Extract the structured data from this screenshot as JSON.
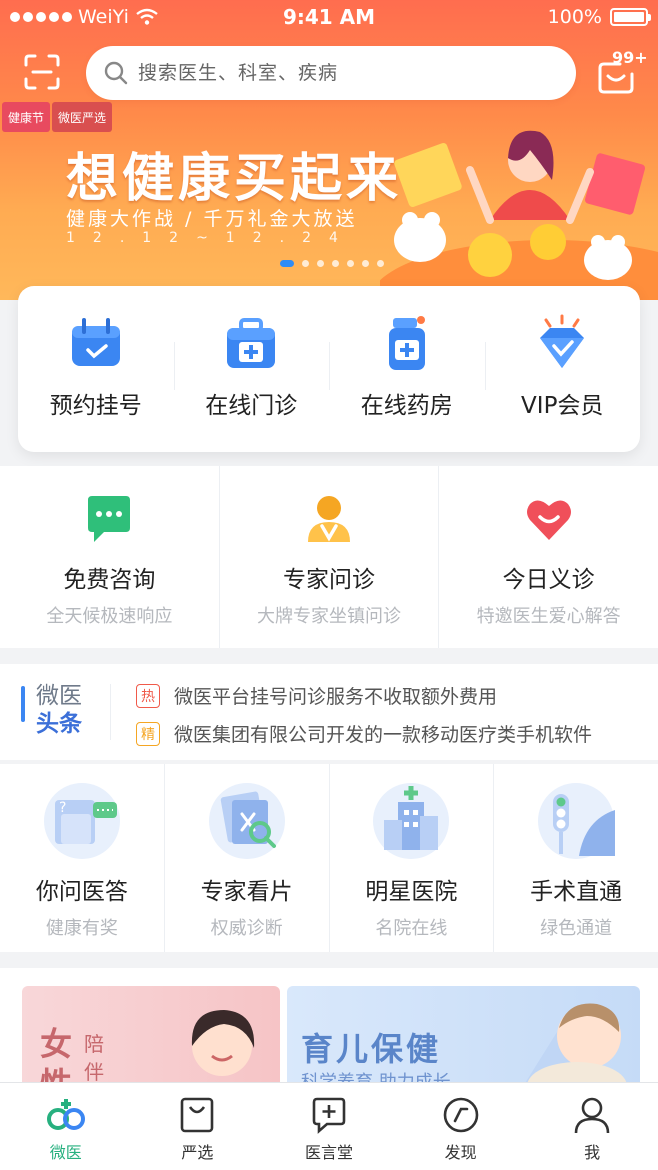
{
  "status_bar": {
    "signal_dots": 5,
    "carrier": "WeiYi",
    "time": "9:41 AM",
    "battery": "100%"
  },
  "header": {
    "search_placeholder": "搜索医生、科室、疾病",
    "message_badge": "99+"
  },
  "banner": {
    "badges": [
      "健康节",
      "微医严选"
    ],
    "title": "想健康买起来",
    "subtitle": "健康大作战 / 千万礼金大放送",
    "date": "12.12~12.24",
    "carousel_count": 7,
    "carousel_active": 0
  },
  "main_services": [
    {
      "label": "预约挂号",
      "icon": "calendar-icon"
    },
    {
      "label": "在线门诊",
      "icon": "medical-kit-icon"
    },
    {
      "label": "在线药房",
      "icon": "medicine-bottle-icon"
    },
    {
      "label": "VIP会员",
      "icon": "diamond-icon"
    }
  ],
  "consult": [
    {
      "title": "免费咨询",
      "subtitle": "全天候极速响应",
      "icon": "chat-bubble-icon"
    },
    {
      "title": "专家问诊",
      "subtitle": "大牌专家坐镇问诊",
      "icon": "doctor-icon"
    },
    {
      "title": "今日义诊",
      "subtitle": "特邀医生爱心解答",
      "icon": "heart-icon"
    }
  ],
  "news": {
    "brand_top": "微医",
    "brand_bottom": "头条",
    "items": [
      {
        "tag": "热",
        "text": "微医平台挂号问诊服务不收取额外费用"
      },
      {
        "tag": "精",
        "text": "微医集团有限公司开发的一款移动医疗类手机软件"
      }
    ]
  },
  "services": [
    {
      "title": "你问医答",
      "subtitle": "健康有奖",
      "icon": "qa-icon"
    },
    {
      "title": "专家看片",
      "subtitle": "权威诊断",
      "icon": "xray-icon"
    },
    {
      "title": "明星医院",
      "subtitle": "名院在线",
      "icon": "hospital-icon"
    },
    {
      "title": "手术直通",
      "subtitle": "绿色通道",
      "icon": "traffic-road-icon"
    }
  ],
  "promos": [
    {
      "big": "女性",
      "small": "陪伴"
    },
    {
      "big": "育儿保健",
      "small": "科学养育 助力成长"
    }
  ],
  "tabbar": [
    {
      "label": "微医",
      "icon": "weiyi-logo-icon",
      "active": true
    },
    {
      "label": "严选",
      "icon": "shopping-bag-icon",
      "active": false
    },
    {
      "label": "医言堂",
      "icon": "message-plus-icon",
      "active": false
    },
    {
      "label": "发现",
      "icon": "compass-icon",
      "active": false
    },
    {
      "label": "我",
      "icon": "user-icon",
      "active": false
    }
  ],
  "colors": {
    "accent_orange": "#ff6d4f",
    "primary_blue": "#3b86f2",
    "active_green": "#27b07f"
  }
}
